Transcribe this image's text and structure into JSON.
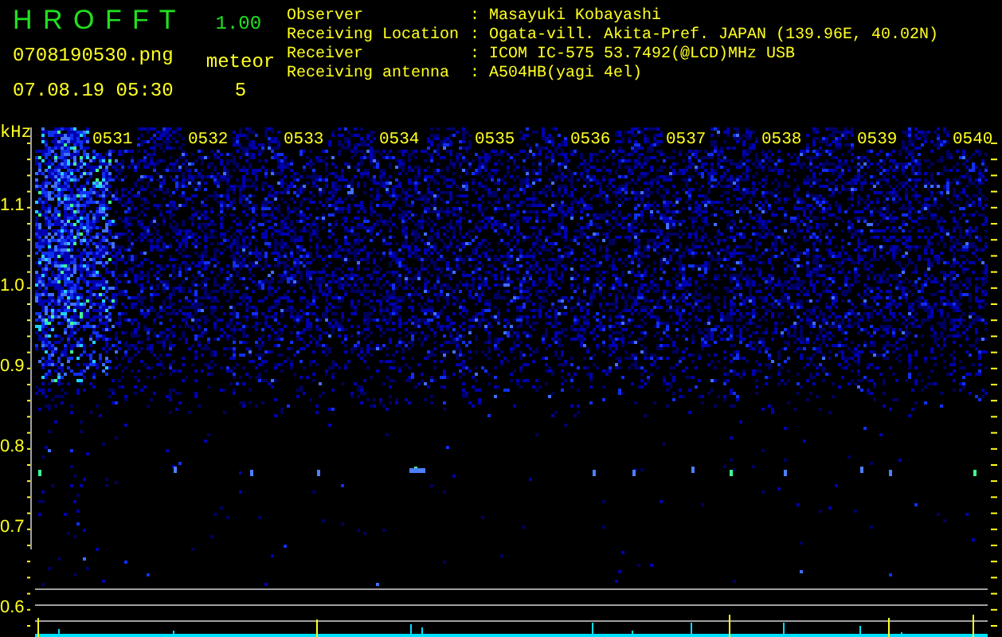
{
  "header": {
    "app_title": "H R O F F T",
    "version": "1.00",
    "filename": "0708190530.png",
    "datetime": "07.08.19 05:30",
    "meteor_label": "meteor",
    "meteor_count": "5"
  },
  "station": [
    {
      "label": "Observer",
      "separator": ":",
      "value": "Masayuki Kobayashi"
    },
    {
      "label": "Receiving Location",
      "separator": ":",
      "value": "Ogata-vill. Akita-Pref. JAPAN (139.96E, 40.02N)"
    },
    {
      "label": "Receiver",
      "separator": ":",
      "value": "ICOM IC-575 53.7492(@LCD)MHz USB"
    },
    {
      "label": "Receiving antenna",
      "separator": ":",
      "value": "A504HB(yagi 4el)"
    }
  ],
  "spectrogram": {
    "unit": "kHz",
    "freq_labels": [
      "1.1",
      "1.0",
      "0.9",
      "0.8",
      "0.7",
      "0.6"
    ],
    "time_labels": [
      "0531",
      "0532",
      "0533",
      "0534",
      "0535",
      "0536",
      "0537",
      "0538",
      "0539",
      "0540"
    ]
  }
}
